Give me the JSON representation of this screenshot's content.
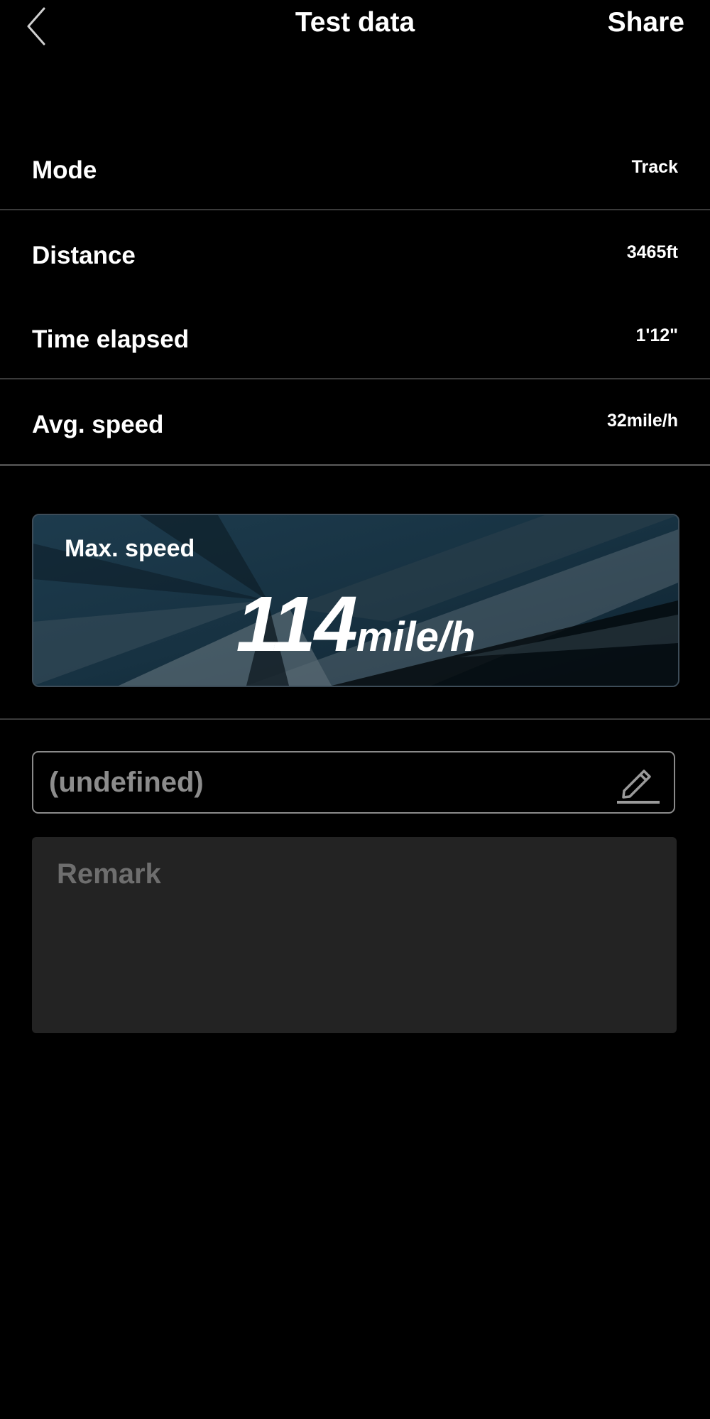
{
  "header": {
    "title": "Test data",
    "share_label": "Share",
    "back_icon": "chevron-left-icon"
  },
  "rows": [
    {
      "label": "Mode",
      "value": "Track"
    },
    {
      "label": "Distance",
      "value": "3465ft"
    },
    {
      "label": "Time elapsed",
      "value": "1'12\""
    },
    {
      "label": "Avg. speed",
      "value": "32mile/h"
    }
  ],
  "max_speed": {
    "label": "Max. speed",
    "value": "114",
    "unit": "mile/h"
  },
  "name_field": {
    "value": "(undefined)",
    "edit_icon": "pencil-icon"
  },
  "remark": {
    "placeholder": "Remark"
  },
  "colors": {
    "background": "#000000",
    "card_base": "#16303f",
    "remark_bg": "#232323",
    "muted_text": "#8c8c8c"
  }
}
